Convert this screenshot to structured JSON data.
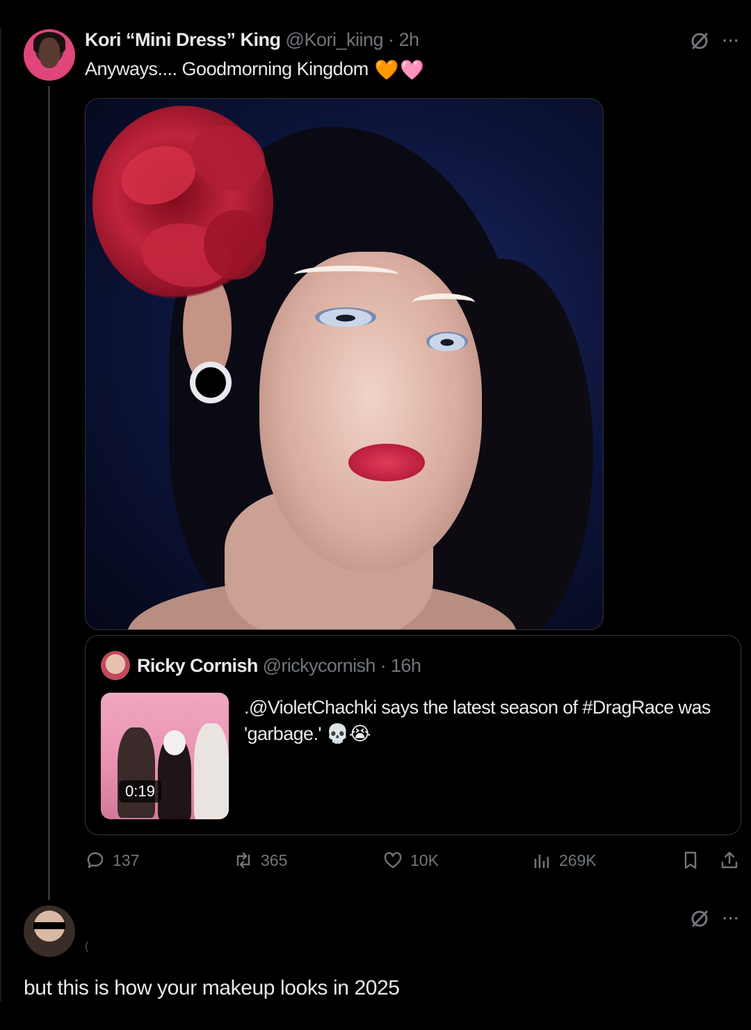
{
  "main_tweet": {
    "display_name": "Kori “Mini Dress” King",
    "handle_time": "@Kori_kiing · 2h",
    "text": "Anyways.... Goodmorning Kingdom",
    "emojis": [
      "🧡",
      "🩷"
    ],
    "more_label": "···"
  },
  "quote": {
    "display_name": "Ricky Cornish",
    "handle_time": "@rickycornish · 16h",
    "text": ".@VioletChachki says the latest season of #DragRace was 'garbage.' 💀😭",
    "video_duration": "0:19"
  },
  "actions": {
    "replies": "137",
    "retweets": "365",
    "likes": "10K",
    "views": "269K"
  },
  "reply": {
    "marker": "(",
    "text": "but this is how your makeup looks in 2025",
    "more_label": "···"
  },
  "colors": {
    "background": "#000000",
    "text": "#e7e9ea",
    "secondary": "#71767b",
    "border": "#333639"
  }
}
